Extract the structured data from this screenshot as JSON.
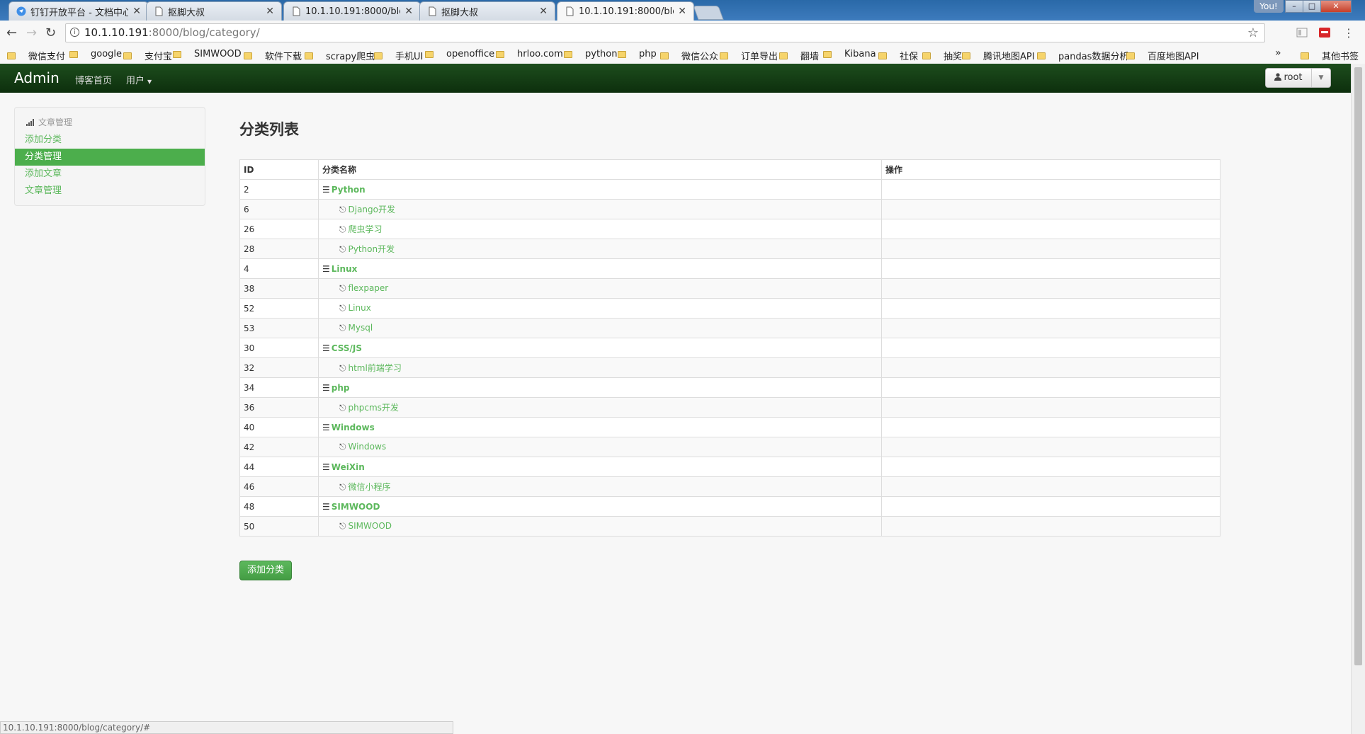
{
  "browser": {
    "tabs": [
      {
        "title": "钉钉开放平台 - 文档中心",
        "active": false
      },
      {
        "title": "抠脚大叔",
        "active": false
      },
      {
        "title": "10.1.10.191:8000/blog/",
        "active": false
      },
      {
        "title": "抠脚大叔",
        "active": false
      },
      {
        "title": "10.1.10.191:8000/blog/",
        "active": true
      }
    ],
    "window_user": "You!",
    "url_host": "10.1.10.191",
    "url_path": ":8000/blog/category/",
    "bookmarks": [
      "微信支付",
      "google",
      "支付宝",
      "SIMWOOD",
      "软件下载",
      "scrapy爬虫",
      "手机UI",
      "openoffice",
      "hrloo.com",
      "python",
      "php",
      "微信公众",
      "订单导出",
      "翻墙",
      "Kibana",
      "社保",
      "抽奖",
      "腾讯地图API",
      "pandas数据分析",
      "百度地图API"
    ],
    "bookmarks_more": "»",
    "other_bookmarks": "其他书签",
    "status_url": "10.1.10.191:8000/blog/category/#"
  },
  "header": {
    "brand": "Admin",
    "links": [
      "博客首页",
      "用户"
    ],
    "user": "root"
  },
  "sidebar": {
    "header": "文章管理",
    "items": [
      {
        "label": "添加分类",
        "active": false
      },
      {
        "label": "分类管理",
        "active": true
      },
      {
        "label": "添加文章",
        "active": false
      },
      {
        "label": "文章管理",
        "active": false
      }
    ]
  },
  "main": {
    "title": "分类列表",
    "columns": [
      "ID",
      "分类名称",
      "操作"
    ],
    "rows": [
      {
        "id": "2",
        "name": "Python",
        "parent": true
      },
      {
        "id": "6",
        "name": "Django开发",
        "parent": false
      },
      {
        "id": "26",
        "name": "爬虫学习",
        "parent": false
      },
      {
        "id": "28",
        "name": "Python开发",
        "parent": false
      },
      {
        "id": "4",
        "name": "Linux",
        "parent": true
      },
      {
        "id": "38",
        "name": "flexpaper",
        "parent": false
      },
      {
        "id": "52",
        "name": "Linux",
        "parent": false
      },
      {
        "id": "53",
        "name": "Mysql",
        "parent": false
      },
      {
        "id": "30",
        "name": "CSS/JS",
        "parent": true
      },
      {
        "id": "32",
        "name": "html前端学习",
        "parent": false
      },
      {
        "id": "34",
        "name": "php",
        "parent": true
      },
      {
        "id": "36",
        "name": "phpcms开发",
        "parent": false
      },
      {
        "id": "40",
        "name": "Windows",
        "parent": true
      },
      {
        "id": "42",
        "name": "Windows",
        "parent": false
      },
      {
        "id": "44",
        "name": "WeiXin",
        "parent": true
      },
      {
        "id": "46",
        "name": "微信小程序",
        "parent": false
      },
      {
        "id": "48",
        "name": "SIMWOOD",
        "parent": true
      },
      {
        "id": "50",
        "name": "SIMWOOD",
        "parent": false
      }
    ],
    "add_button": "添加分类"
  },
  "colors": {
    "accent": "#5cb85c",
    "navbar": "#0d2f0d"
  }
}
